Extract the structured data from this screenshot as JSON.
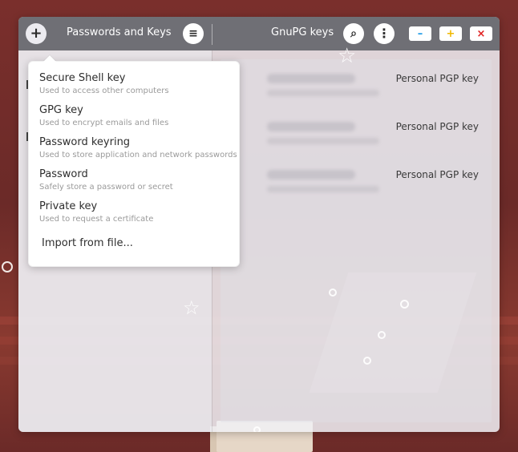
{
  "headerbar": {
    "left_title": "Passwords and Keys",
    "right_title": "GnuPG keys",
    "icons": {
      "add": "+",
      "menu": "≡",
      "search": "⌕",
      "more": "⋮",
      "minimize": "–",
      "maximize": "+",
      "close": "×"
    }
  },
  "popover": {
    "items": [
      {
        "title": "Secure Shell key",
        "subtitle": "Used to access other computers"
      },
      {
        "title": "GPG key",
        "subtitle": "Used to encrypt emails and files"
      },
      {
        "title": "Password keyring",
        "subtitle": "Used to store application and network passwords"
      },
      {
        "title": "Password",
        "subtitle": "Safely store a password or secret"
      },
      {
        "title": "Private key",
        "subtitle": "Used to request a certificate"
      }
    ],
    "import_label": "Import from file..."
  },
  "keys": {
    "rows": [
      {
        "type": "Personal PGP key"
      },
      {
        "type": "Personal PGP key"
      },
      {
        "type": "Personal PGP key"
      }
    ]
  },
  "colors": {
    "headerbar": "#6f6f75",
    "key_icon": "#d8a52a",
    "minimize": "#1f9be6",
    "maximize": "#f0b800",
    "close": "#e02020"
  }
}
